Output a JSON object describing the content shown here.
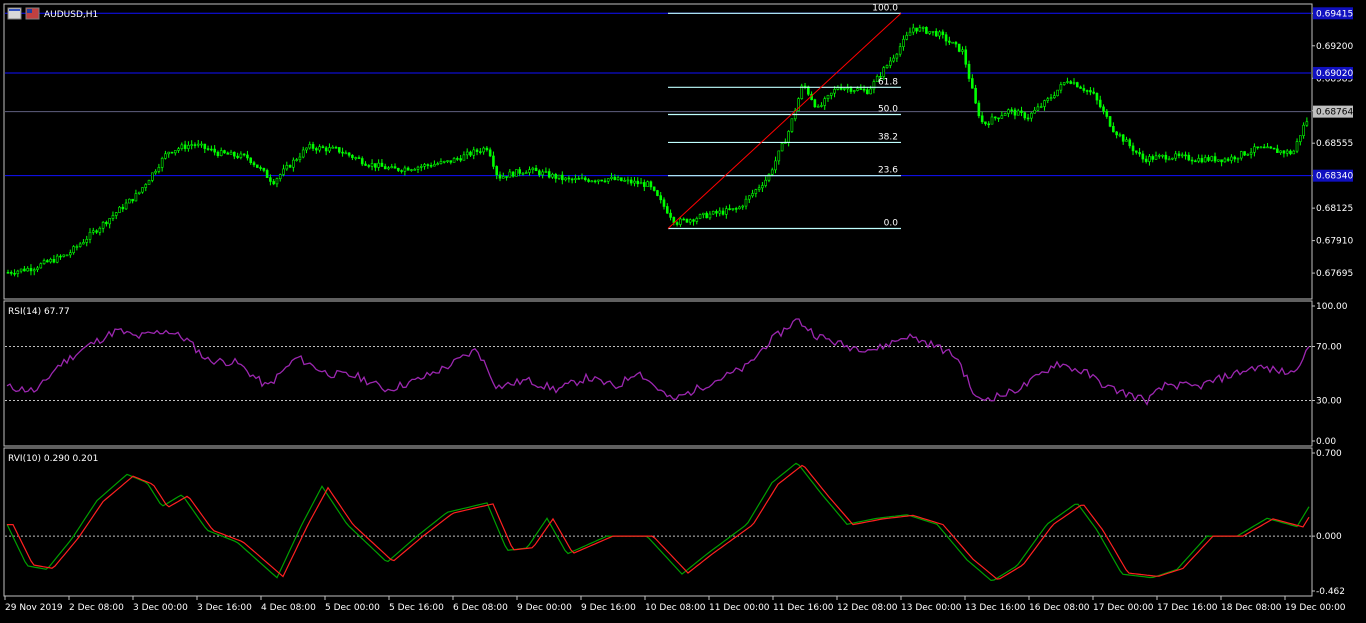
{
  "window": {
    "symbol_label": "AUDUSD,H1"
  },
  "colors": {
    "background": "#000000",
    "frame": "#c0c0c0",
    "bull_candle": "#00ff00",
    "bear_candle": "#00ff00",
    "hline": "#1010ff",
    "fibo_level": "#c0ffff",
    "fibo_trend": "#ff0000",
    "rsi_line": "#9c27b0",
    "rvi_main": "#00a000",
    "rvi_signal": "#ff2020",
    "dotted": "#c0c0c0",
    "current_price_box": "#c0c0c0"
  },
  "main_panel": {
    "price_axis": [
      "0.69415",
      "0.69200",
      "0.68985",
      "0.68770",
      "0.68555",
      "0.68340",
      "0.68125",
      "0.67910",
      "0.67695"
    ],
    "price_range": [
      0.6753,
      0.6947
    ],
    "horizontal_lines": [
      {
        "price": 0.69415,
        "label": "0.69415"
      },
      {
        "price": 0.6902,
        "label": "0.69020"
      },
      {
        "price": 0.6834,
        "label": "0.68340"
      }
    ],
    "current_price": {
      "price": 0.68764,
      "label": "0.68764"
    },
    "fibonacci": {
      "levels": [
        {
          "label": "100.0",
          "price": 0.69415
        },
        {
          "label": "61.8",
          "price": 0.68925
        },
        {
          "label": "50.0",
          "price": 0.68745
        },
        {
          "label": "38.2",
          "price": 0.6856
        },
        {
          "label": "23.6",
          "price": 0.6834
        },
        {
          "label": "0.0",
          "price": 0.6799
        }
      ]
    }
  },
  "rsi_panel": {
    "title": "RSI(14) 67.77",
    "axis": [
      "100.00",
      "70.00",
      "30.00",
      "0.00"
    ],
    "levels": [
      70,
      30
    ],
    "range": [
      0,
      100
    ]
  },
  "rvi_panel": {
    "title": "RVI(10) 0.290 0.201",
    "axis": [
      "0.700",
      "0.000",
      "-0.462"
    ],
    "range": [
      -0.462,
      0.7
    ]
  },
  "time_axis": [
    "29 Nov 2019",
    "2 Dec 08:00",
    "3 Dec 00:00",
    "3 Dec 16:00",
    "4 Dec 08:00",
    "5 Dec 00:00",
    "5 Dec 16:00",
    "6 Dec 08:00",
    "9 Dec 00:00",
    "9 Dec 16:00",
    "10 Dec 08:00",
    "11 Dec 00:00",
    "11 Dec 16:00",
    "12 Dec 08:00",
    "13 Dec 00:00",
    "13 Dec 16:00",
    "16 Dec 08:00",
    "17 Dec 00:00",
    "17 Dec 16:00",
    "18 Dec 08:00",
    "19 Dec 00:00"
  ]
}
